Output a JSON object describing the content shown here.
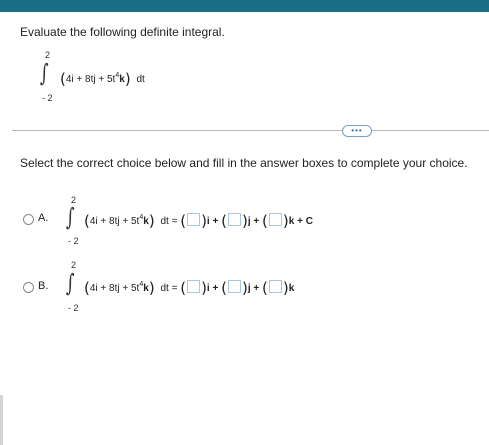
{
  "question": {
    "prompt": "Evaluate the following definite integral.",
    "upper_limit": "2",
    "lower_limit": "- 2",
    "integrand_prefix": "4i + 8tj + 5t",
    "exponent": "4",
    "unit_k": "k",
    "differential": "dt"
  },
  "divider": {
    "more_label": "•••"
  },
  "instructions": "Select the correct choice below and fill in the answer boxes to complete your choice.",
  "choices": [
    {
      "letter": "A.",
      "upper_limit": "2",
      "lower_limit": "- 2",
      "lhs_prefix": "4i + 8tj + 5t",
      "exponent": "4",
      "unit_k": "k",
      "differential": "dt =",
      "rhs_i": "i +",
      "rhs_j": "j +",
      "rhs_k": "k + C"
    },
    {
      "letter": "B.",
      "upper_limit": "2",
      "lower_limit": "- 2",
      "lhs_prefix": "4i + 8tj + 5t",
      "exponent": "4",
      "unit_k": "k",
      "differential": "dt =",
      "rhs_i": "i +",
      "rhs_j": "j +",
      "rhs_k": "k"
    }
  ]
}
